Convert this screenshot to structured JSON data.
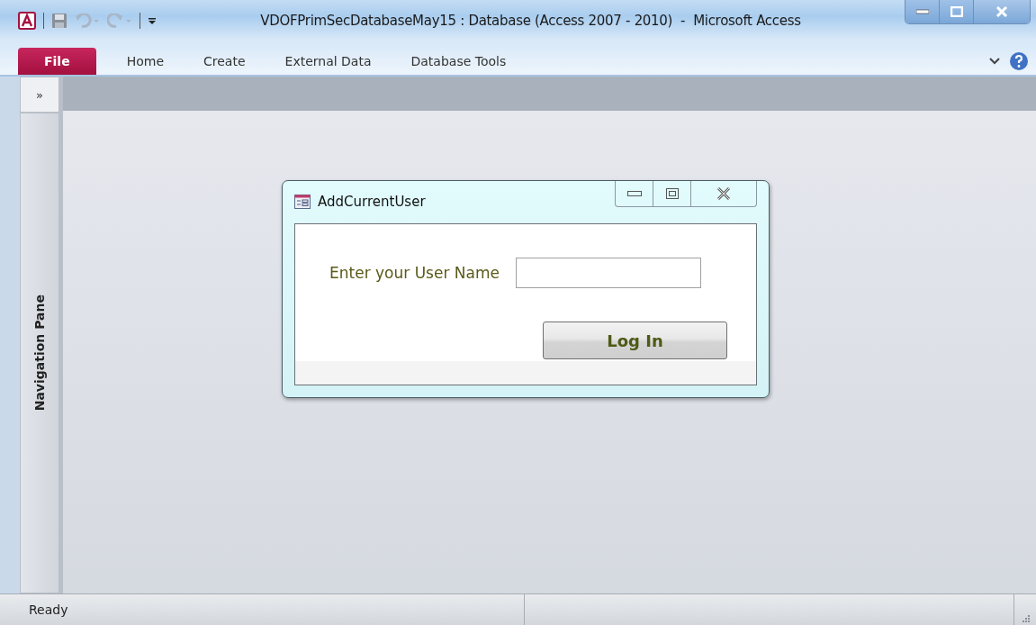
{
  "window": {
    "title": "VDOFPrimSecDatabaseMay15 : Database (Access 2007 - 2010)  -  Microsoft Access"
  },
  "tabs": [
    {
      "label": "File",
      "selected": true
    },
    {
      "label": "Home",
      "selected": false
    },
    {
      "label": "Create",
      "selected": false
    },
    {
      "label": "External Data",
      "selected": false
    },
    {
      "label": "Database Tools",
      "selected": false
    }
  ],
  "navigation_pane": {
    "toggle": "»",
    "label": "Navigation Pane"
  },
  "dialog": {
    "title": "AddCurrentUser",
    "field_label": "Enter your User Name",
    "button": "Log In"
  },
  "status_bar": {
    "text": "Ready"
  }
}
